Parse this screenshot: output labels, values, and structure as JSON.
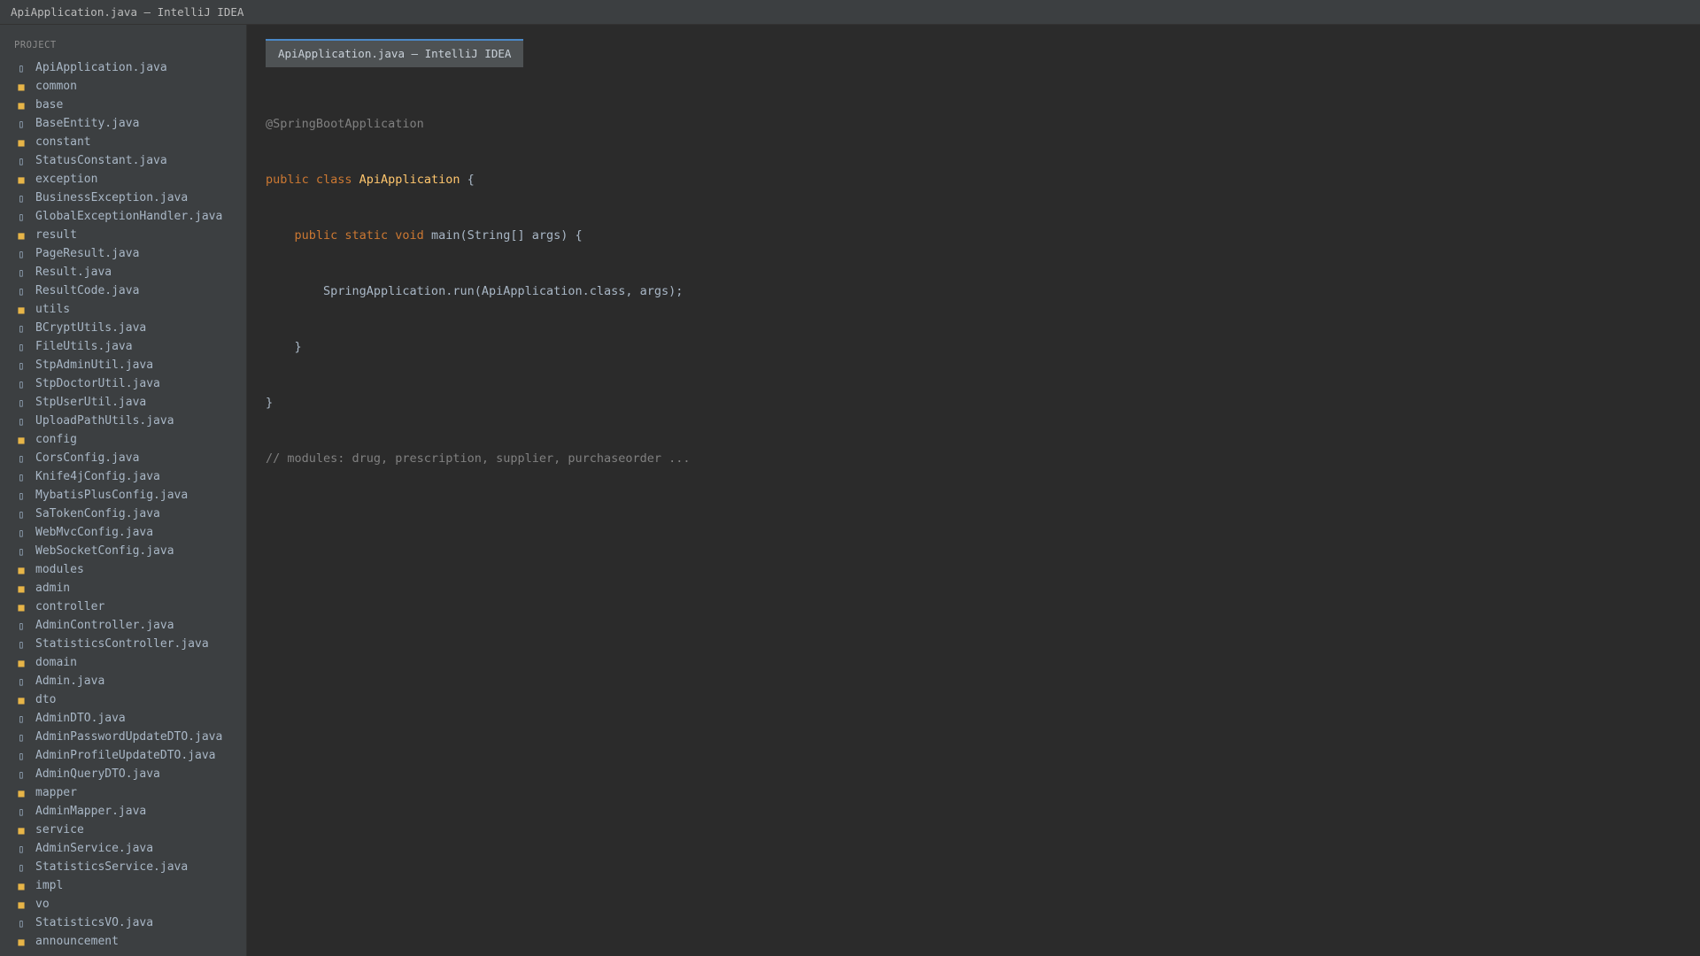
{
  "window": {
    "title": "ApiApplication.java — IntelliJ IDEA"
  },
  "sidebar": {
    "header": "PROJECT",
    "items": [
      {
        "label": "ApiApplication.java",
        "type": "file"
      },
      {
        "label": "common",
        "type": "folder"
      },
      {
        "label": "base",
        "type": "folder"
      },
      {
        "label": "BaseEntity.java",
        "type": "file"
      },
      {
        "label": "constant",
        "type": "folder"
      },
      {
        "label": "StatusConstant.java",
        "type": "file"
      },
      {
        "label": "exception",
        "type": "folder"
      },
      {
        "label": "BusinessException.java",
        "type": "file"
      },
      {
        "label": "GlobalExceptionHandler.java",
        "type": "file"
      },
      {
        "label": "result",
        "type": "folder"
      },
      {
        "label": "PageResult.java",
        "type": "file"
      },
      {
        "label": "Result.java",
        "type": "file"
      },
      {
        "label": "ResultCode.java",
        "type": "file"
      },
      {
        "label": "utils",
        "type": "folder"
      },
      {
        "label": "BCryptUtils.java",
        "type": "file"
      },
      {
        "label": "FileUtils.java",
        "type": "file"
      },
      {
        "label": "StpAdminUtil.java",
        "type": "file"
      },
      {
        "label": "StpDoctorUtil.java",
        "type": "file"
      },
      {
        "label": "StpUserUtil.java",
        "type": "file"
      },
      {
        "label": "UploadPathUtils.java",
        "type": "file"
      },
      {
        "label": "config",
        "type": "folder"
      },
      {
        "label": "CorsConfig.java",
        "type": "file"
      },
      {
        "label": "Knife4jConfig.java",
        "type": "file"
      },
      {
        "label": "MybatisPlusConfig.java",
        "type": "file"
      },
      {
        "label": "SaTokenConfig.java",
        "type": "file"
      },
      {
        "label": "WebMvcConfig.java",
        "type": "file"
      },
      {
        "label": "WebSocketConfig.java",
        "type": "file"
      },
      {
        "label": "modules",
        "type": "folder"
      },
      {
        "label": "admin",
        "type": "folder"
      },
      {
        "label": "controller",
        "type": "folder"
      },
      {
        "label": "AdminController.java",
        "type": "file"
      },
      {
        "label": "StatisticsController.java",
        "type": "file"
      },
      {
        "label": "domain",
        "type": "folder"
      },
      {
        "label": "Admin.java",
        "type": "file"
      },
      {
        "label": "dto",
        "type": "folder"
      },
      {
        "label": "AdminDTO.java",
        "type": "file"
      },
      {
        "label": "AdminPasswordUpdateDTO.java",
        "type": "file"
      },
      {
        "label": "AdminProfileUpdateDTO.java",
        "type": "file"
      },
      {
        "label": "AdminQueryDTO.java",
        "type": "file"
      },
      {
        "label": "mapper",
        "type": "folder"
      },
      {
        "label": "AdminMapper.java",
        "type": "file"
      },
      {
        "label": "service",
        "type": "folder"
      },
      {
        "label": "AdminService.java",
        "type": "file"
      },
      {
        "label": "StatisticsService.java",
        "type": "file"
      },
      {
        "label": "impl",
        "type": "folder"
      },
      {
        "label": "vo",
        "type": "folder"
      },
      {
        "label": "StatisticsVO.java",
        "type": "file"
      },
      {
        "label": "announcement",
        "type": "folder"
      }
    ]
  },
  "editor": {
    "tab_label": "ApiApplication.java — IntelliJ IDEA",
    "code": {
      "l1_annotation": "@SpringBootApplication",
      "l2_kw": "public class ",
      "l2_class": "ApiApplication",
      "l2_rest": " {",
      "l3_indent": "    ",
      "l3_kw": "public static void ",
      "l3_rest": "main(String[] args) {",
      "l4": "        SpringApplication.run(ApiApplication.class, args);",
      "l5": "    }",
      "l6": "}",
      "l7_comment": "// modules: drug, prescription, supplier, purchaseorder ..."
    }
  },
  "colors": {
    "keyword": "#cc7832",
    "class_name": "#ffc66d",
    "comment": "#808080",
    "text": "#a9b7c6",
    "folder_icon": "#e7b548",
    "tab_accent": "#4a88c7"
  }
}
